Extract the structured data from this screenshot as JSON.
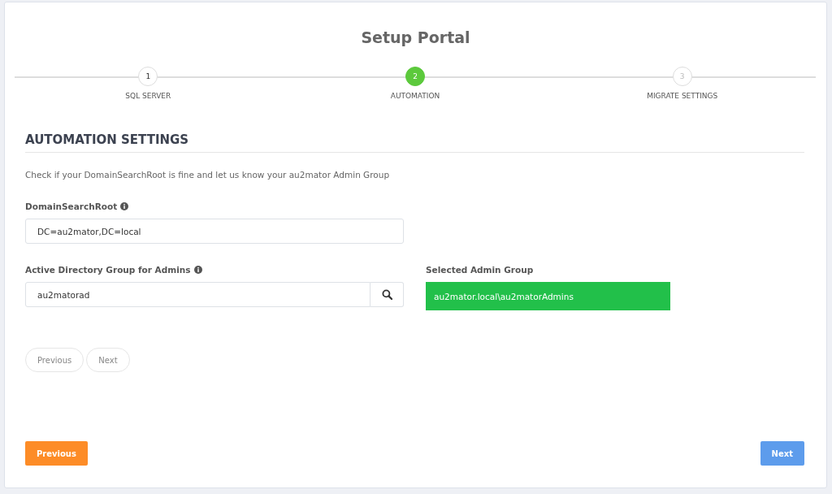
{
  "title": "Setup Portal",
  "steps": [
    {
      "number": "1",
      "label": "SQL SERVER",
      "selected": false,
      "completed": true
    },
    {
      "number": "2",
      "label": "AUTOMATION",
      "selected": true,
      "completed": false
    },
    {
      "number": "3",
      "label": "MIGRATE SETTINGS",
      "selected": false,
      "completed": false
    }
  ],
  "section": {
    "heading": "AUTOMATION SETTINGS",
    "description": "Check if your DomainSearchRoot is fine and let us know your au2mator Admin Group"
  },
  "domain_search_root": {
    "label": "DomainSearchRoot",
    "value": "DC=au2mator,DC=local"
  },
  "admin_group": {
    "label": "Active Directory Group for Admins",
    "value": "au2matorad"
  },
  "selected_admin_group": {
    "label": "Selected Admin Group",
    "value": "au2mator.local\\au2matorAdmins"
  },
  "inner_buttons": [
    "Previous",
    "Next"
  ],
  "footer": {
    "previous": "Previous",
    "next": "Next"
  }
}
